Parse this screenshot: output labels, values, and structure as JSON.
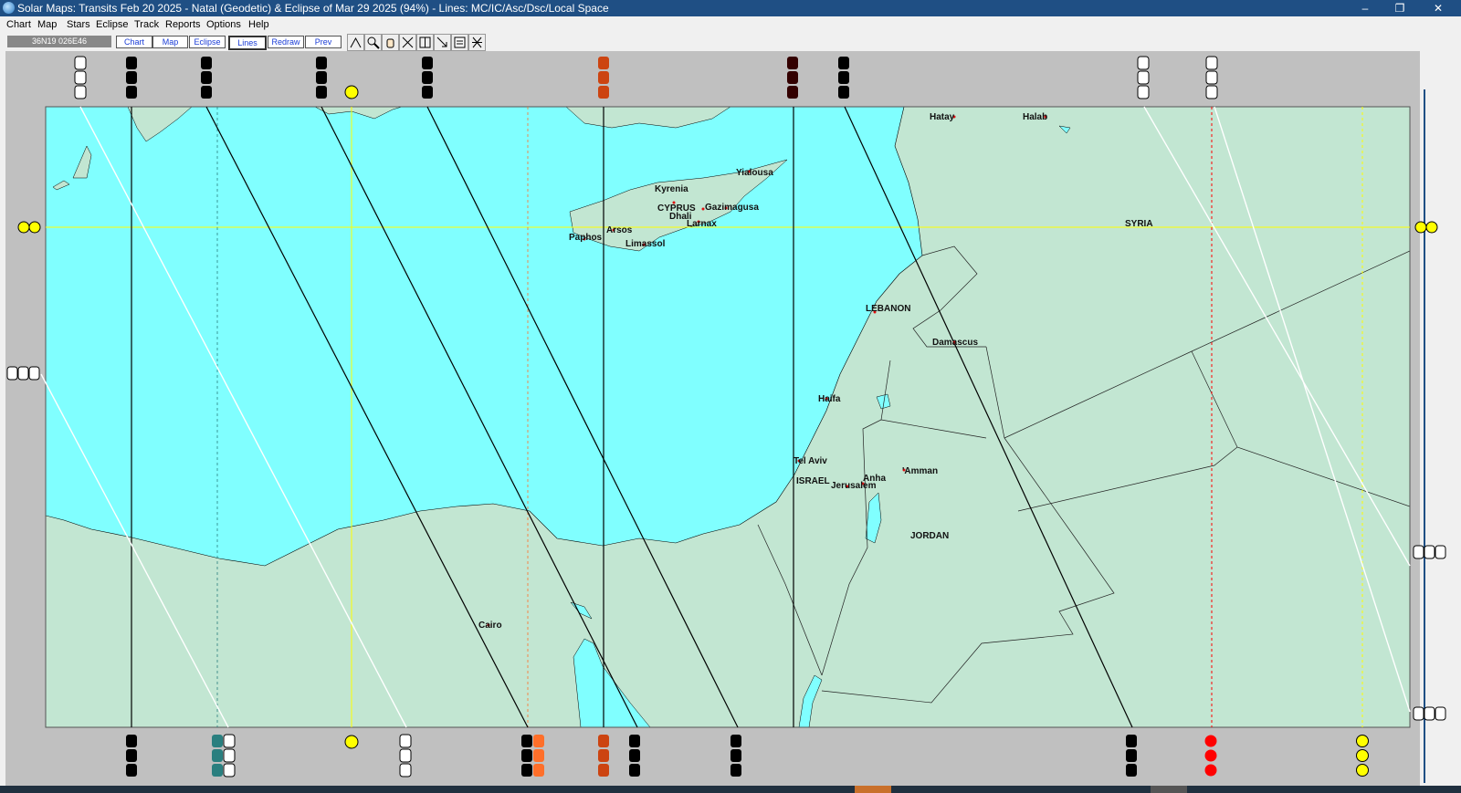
{
  "window": {
    "title": "Solar Maps: Transits Feb 20 2025 - Natal (Geodetic)  & Eclipse of Mar 29 2025 (94%) - Lines: MC/IC/Asc/Dsc/Local Space",
    "minimize": "–",
    "restore": "❐",
    "close": "✕"
  },
  "menu": [
    "Chart",
    "Map",
    "Stars",
    "Eclipse",
    "Track",
    "Reports",
    "Options",
    "Help"
  ],
  "toolbar": {
    "coordinates": "36N19 026E46",
    "buttons": [
      "Chart",
      "Map",
      "Eclipse",
      "Lines",
      "Redraw",
      "Prev"
    ],
    "tools": [
      "crosshair-tool-icon",
      "zoom-tool-icon",
      "pan-hand-tool-icon",
      "measure-tool-icon",
      "grid-tool-icon",
      "arrow-tool-icon",
      "text-tool-icon",
      "clear-lines-tool-icon"
    ]
  },
  "map": {
    "colors": {
      "sea": "#80ffff",
      "land": "#c2e6d2",
      "frame": "#c0c0c0",
      "sun_line": "#ffff00",
      "mars_line": "#ff0000",
      "black_line": "#000000",
      "white_line": "#ffffff",
      "border": "#333333"
    },
    "labels": {
      "hatay": "Hatay",
      "halab": "Halab",
      "syria": "SYRIA",
      "kyrenia": "Kyrenia",
      "yialousa": "Yialousa",
      "cyprus": "CYPRUS",
      "dhali": "Dhali",
      "gazimagusa": "Gazimagusa",
      "larnax": "Larnax",
      "arsos": "Arsos",
      "paphos": "Paphos",
      "limassol": "Limassol",
      "lebanon": "LEBANON",
      "damascus": "Damascus",
      "haifa": "Haifa",
      "tel_aviv": "Tel Aviv",
      "israel": "ISRAEL",
      "anha": "Anha",
      "amman": "'Amman",
      "jerusalem": "Jerusalem",
      "jordan": "JORDAN",
      "cairo": "Cairo"
    }
  }
}
